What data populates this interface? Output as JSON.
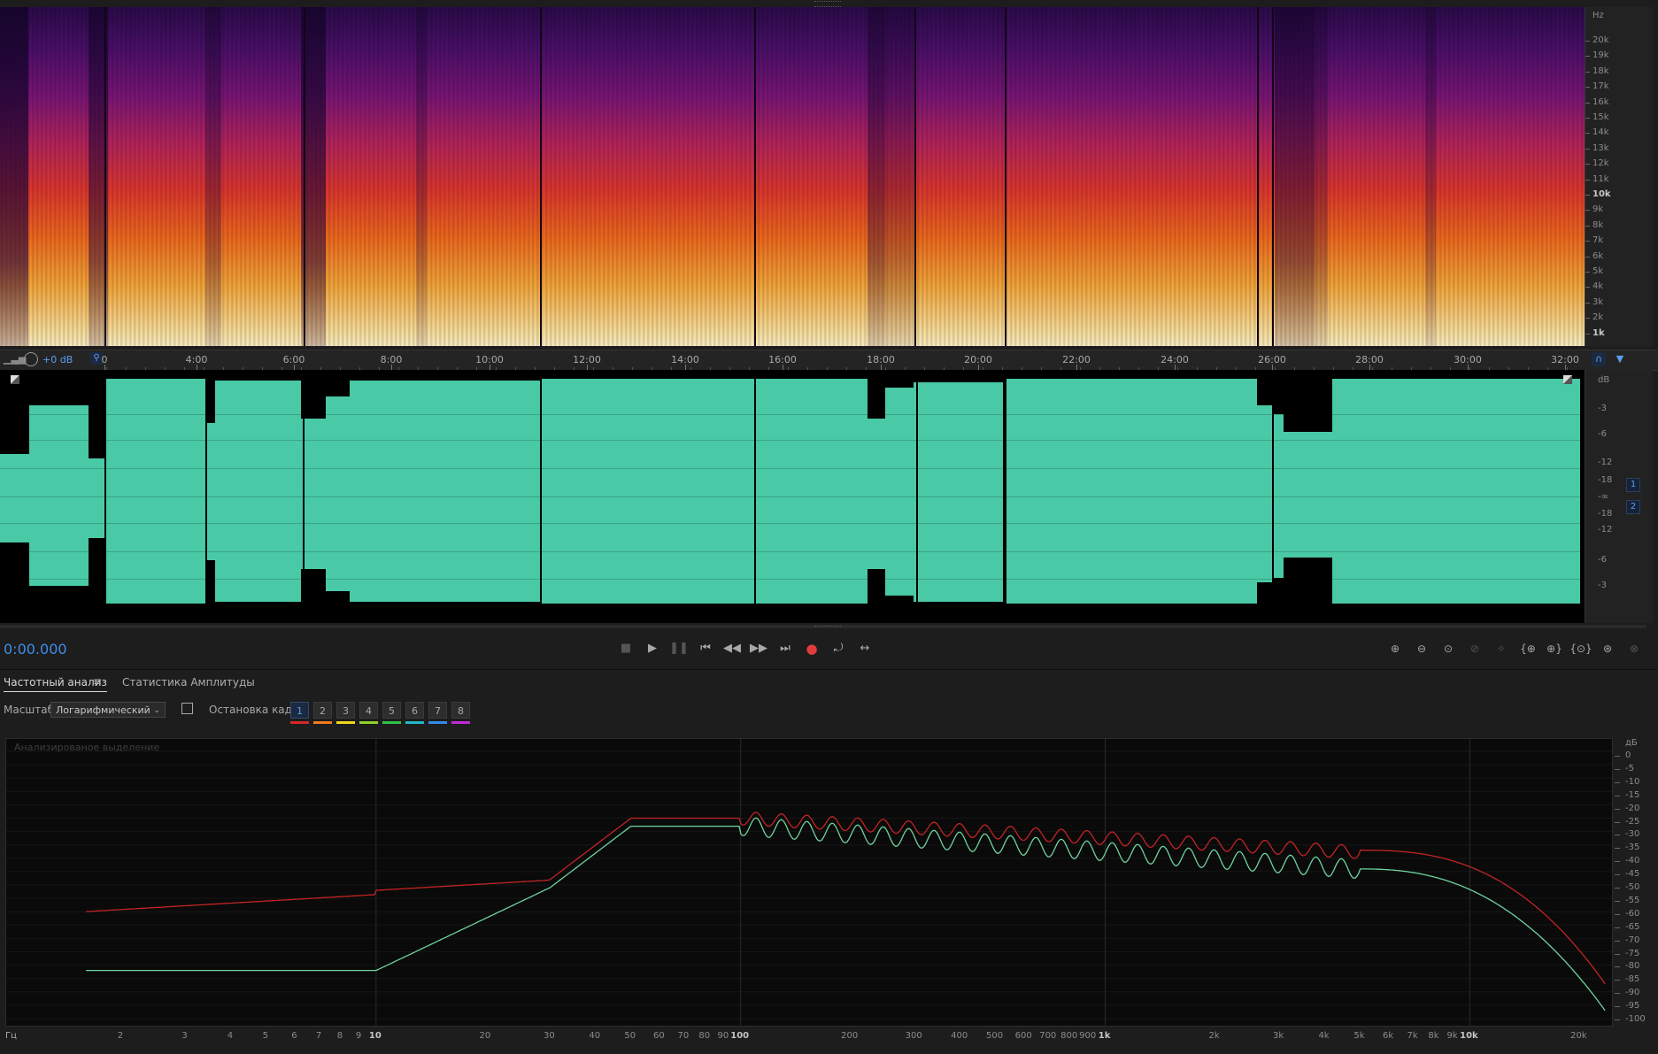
{
  "spectrogram": {
    "unit_label": "Hz",
    "ruler": [
      "20k",
      "19k",
      "18k",
      "17k",
      "16k",
      "15k",
      "14k",
      "13k",
      "12k",
      "11k",
      "10k",
      "9k",
      "8k",
      "7k",
      "6k",
      "5k",
      "4k",
      "3k",
      "2k",
      "1k"
    ]
  },
  "header": {
    "db_offset": "+0 dB"
  },
  "timeline": {
    "labels": [
      "0",
      "4:00",
      "6:00",
      "8:00",
      "10:00",
      "12:00",
      "14:00",
      "16:00",
      "18:00",
      "20:00",
      "22:00",
      "24:00",
      "26:00",
      "28:00",
      "30:00",
      "32:00"
    ]
  },
  "waveform": {
    "unit_label": "dB",
    "ruler": [
      "-3",
      "-6",
      "-12",
      "-18",
      "-∞",
      "-18",
      "-12",
      "-6",
      "-3"
    ],
    "channels": [
      "1",
      "2"
    ],
    "color": "#49c9a6"
  },
  "transport": {
    "time": "0:00.000"
  },
  "panel": {
    "tabs": [
      "Частотный анализ",
      "Статистика Амплитуды"
    ],
    "scale_label": "Масштаб:",
    "scale_value": "Логарифмический",
    "freeze_label": "Остановка кадра:",
    "frames": [
      "1",
      "2",
      "3",
      "4",
      "5",
      "6",
      "7",
      "8"
    ],
    "frame_colors": [
      "#d62828",
      "#f07b19",
      "#f1d61b",
      "#8fd12b",
      "#2fc44a",
      "#1fb9c7",
      "#2f8ce8",
      "#c02bd6"
    ]
  },
  "analysis": {
    "caption": "Анализированое выделение",
    "db_unit": "дБ",
    "db_labels": [
      "0",
      "-5",
      "-10",
      "-15",
      "-20",
      "-25",
      "-30",
      "-35",
      "-40",
      "-45",
      "-50",
      "-55",
      "-60",
      "-65",
      "-70",
      "-75",
      "-80",
      "-85",
      "-90",
      "-95",
      "-100"
    ],
    "hz_unit": "Гц",
    "hz_labels": [
      "2",
      "3",
      "4",
      "5",
      "6",
      "7",
      "8",
      "9",
      "10",
      "20",
      "30",
      "40",
      "50",
      "60",
      "70",
      "80",
      "90",
      "100",
      "200",
      "300",
      "400",
      "500",
      "600",
      "700",
      "800",
      "900",
      "1k",
      "2k",
      "3k",
      "4k",
      "5k",
      "6k",
      "7k",
      "8k",
      "9k",
      "10k",
      "20k"
    ],
    "series_colors": [
      "#c22424",
      "#6fd39e"
    ]
  }
}
